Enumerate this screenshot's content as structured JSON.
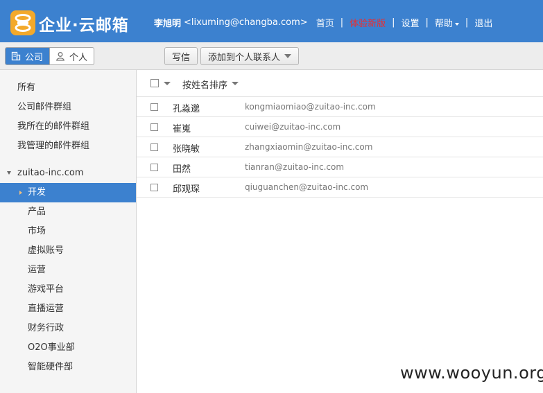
{
  "header": {
    "logo_text": "企业·云邮箱",
    "user_name": "李旭明",
    "user_email": "<lixuming@changba.com>",
    "nav": [
      "首页",
      "体验新版",
      "设置",
      "帮助",
      "退出"
    ]
  },
  "toolbar": {
    "seg_company": "公司",
    "seg_personal": "个人",
    "write_label": "写信",
    "add_contact_label": "添加到个人联系人"
  },
  "sidebar": {
    "top_items": [
      "所有",
      "公司邮件群组",
      "我所在的邮件群组",
      "我管理的邮件群组"
    ],
    "domain": "zuitao-inc.com",
    "departments": [
      "开发",
      "产品",
      "市场",
      "虚拟账号",
      "运营",
      "游戏平台",
      "直播运营",
      "财务行政",
      "O2O事业部",
      "智能硬件部"
    ],
    "active_department": "开发"
  },
  "list": {
    "sort_label": "按姓名排序",
    "contacts": [
      {
        "name": "孔淼邈",
        "email": "kongmiaomiao@zuitao-inc.com"
      },
      {
        "name": "崔嵬",
        "email": "cuiwei@zuitao-inc.com"
      },
      {
        "name": "张晓敏",
        "email": "zhangxiaomin@zuitao-inc.com"
      },
      {
        "name": "田然",
        "email": "tianran@zuitao-inc.com"
      },
      {
        "name": "邱观琛",
        "email": "qiuguanchen@zuitao-inc.com"
      }
    ]
  },
  "watermark": "www.wooyun.org",
  "colors": {
    "brand_blue": "#3c81cf",
    "logo_orange": "#f3a92b",
    "highlight_red": "#ee2c2c"
  }
}
